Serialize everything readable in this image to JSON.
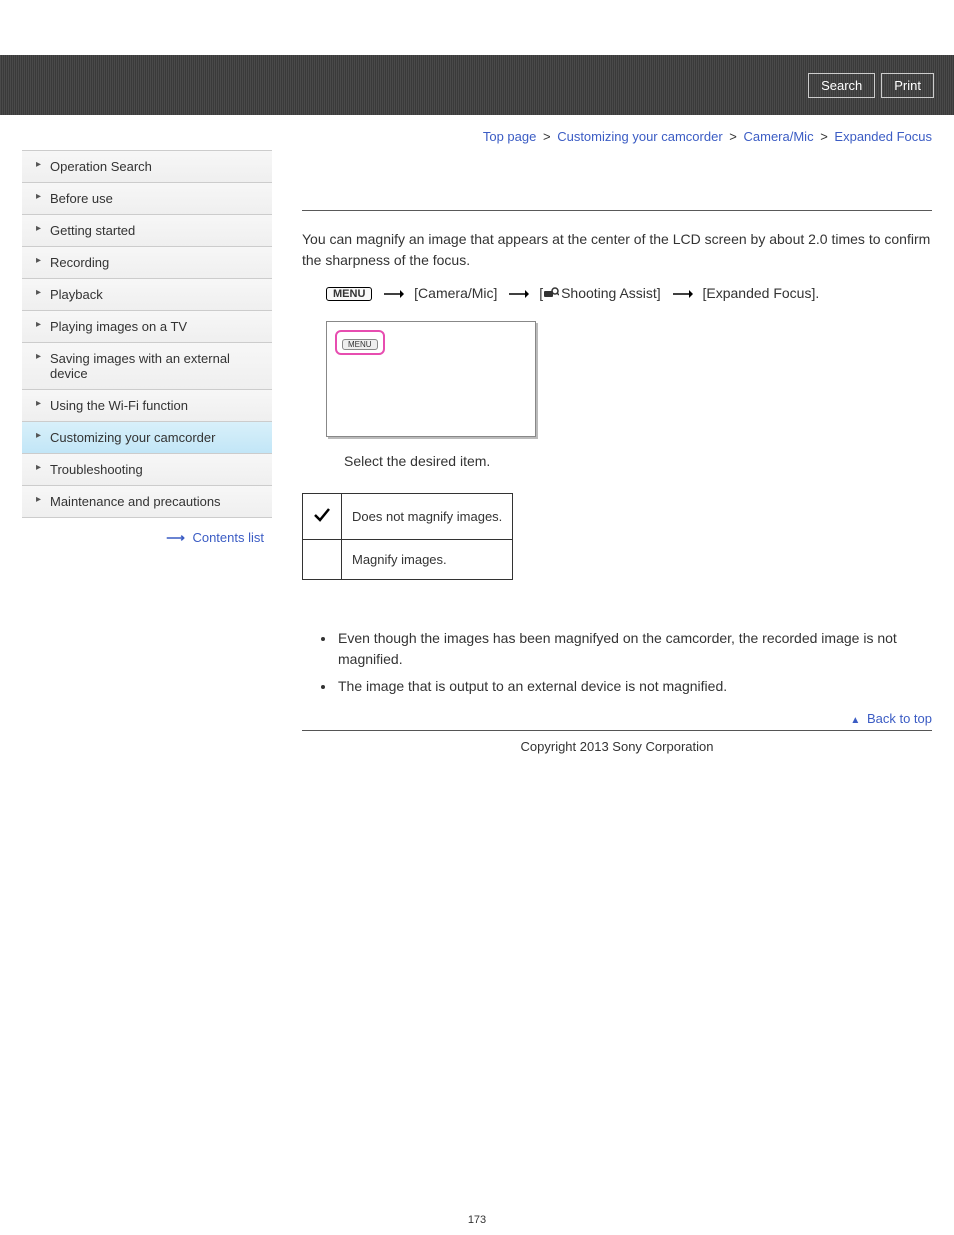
{
  "header": {
    "search": "Search",
    "print": "Print"
  },
  "breadcrumb": {
    "top": "Top page",
    "cat": "Customizing your camcorder",
    "sub": "Camera/Mic",
    "page": "Expanded Focus"
  },
  "sidebar": {
    "items": [
      {
        "label": "Operation Search"
      },
      {
        "label": "Before use"
      },
      {
        "label": "Getting started"
      },
      {
        "label": "Recording"
      },
      {
        "label": "Playback"
      },
      {
        "label": "Playing images on a TV"
      },
      {
        "label": "Saving images with an external device"
      },
      {
        "label": "Using the Wi-Fi function"
      },
      {
        "label": "Customizing your camcorder"
      },
      {
        "label": "Troubleshooting"
      },
      {
        "label": "Maintenance and precautions"
      }
    ],
    "contents_list": "Contents list"
  },
  "main": {
    "intro": "You can magnify an image that appears at the center of the LCD screen by about 2.0 times to confirm the sharpness of the focus.",
    "menu_label": "MENU",
    "path1": "[Camera/Mic]",
    "path2_prefix": "[",
    "path2_text": "Shooting Assist]",
    "path3": "[Expanded Focus].",
    "thumb": "MENU",
    "step": "Select the desired item.",
    "table": {
      "row1": "Does not magnify images.",
      "row2": "Magnify images."
    },
    "note1": "Even though the images has been magnifyed on the camcorder, the recorded image is not magnified.",
    "note2": "The image that is output to an external device is not magnified.",
    "back_to_top": "Back to top",
    "copyright": "Copyright 2013 Sony Corporation",
    "page_number": "173"
  }
}
